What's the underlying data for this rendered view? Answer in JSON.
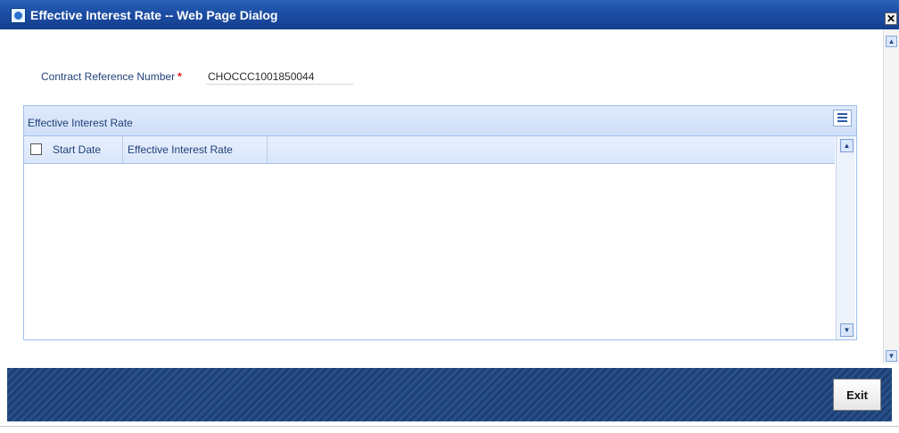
{
  "window": {
    "title": "Effective Interest Rate -- Web Page Dialog",
    "close_glyph": "✕"
  },
  "form": {
    "contract_ref_label": "Contract Reference Number",
    "required_mark": "*",
    "contract_ref_value": "CHOCCC1001850044"
  },
  "panel": {
    "title": "Effective Interest Rate",
    "columns": [
      "Start Date",
      "Effective Interest Rate"
    ],
    "rows": []
  },
  "footer": {
    "exit_label": "Exit"
  },
  "colors": {
    "titlebar": "#1d4fa6",
    "panel_border": "#9fc0ea",
    "footer": "#1e3f73",
    "required": "#e01010"
  }
}
